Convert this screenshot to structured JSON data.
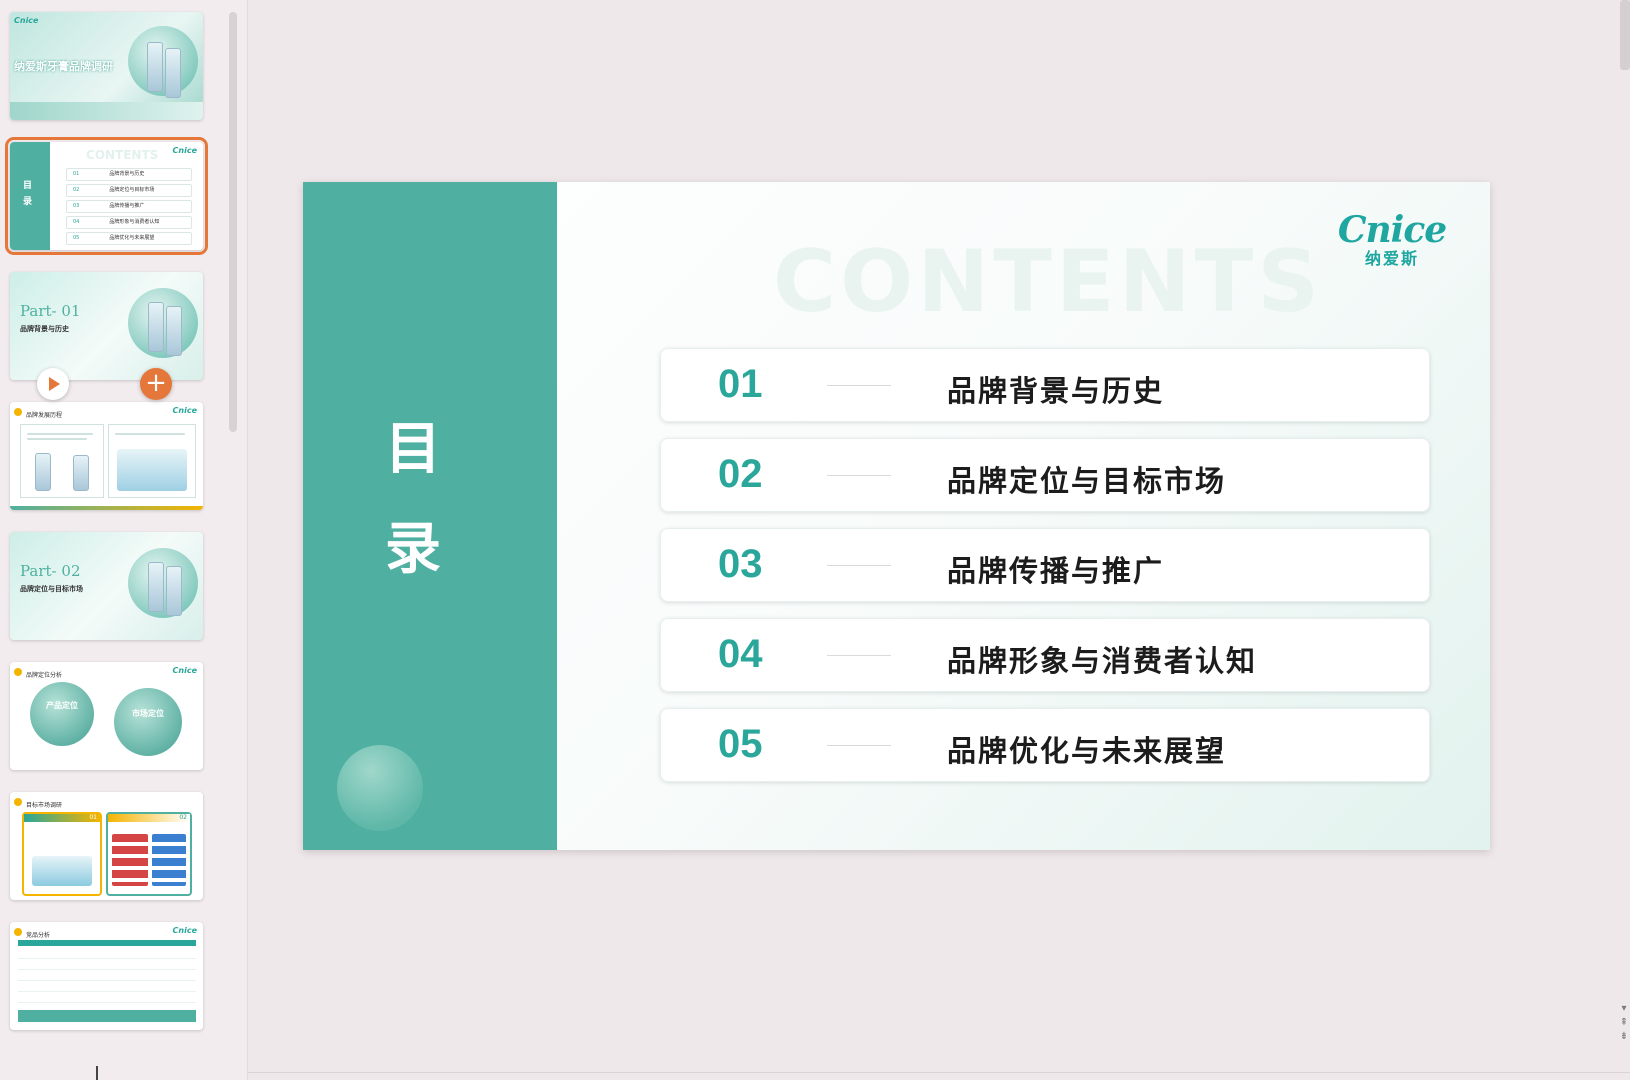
{
  "thumbnails": {
    "t1": {
      "title": "纳爱斯牙膏品牌调研",
      "logo": "Cnice"
    },
    "t2": {
      "watermark": "CONTENTS",
      "side": [
        "目",
        "录"
      ],
      "logo": "Cnice",
      "items": [
        {
          "num": "01",
          "label": "品牌背景与历史"
        },
        {
          "num": "02",
          "label": "品牌定位与目标市场"
        },
        {
          "num": "03",
          "label": "品牌传播与推广"
        },
        {
          "num": "04",
          "label": "品牌形象与消费者认知"
        },
        {
          "num": "05",
          "label": "品牌优化与未来展望"
        }
      ]
    },
    "t3": {
      "part": "Part- 01",
      "subtitle": "品牌背景与历史"
    },
    "t4": {
      "title": "品牌发展历程",
      "logo": "Cnice"
    },
    "t5": {
      "part": "Part- 02",
      "subtitle": "品牌定位与目标市场"
    },
    "t6": {
      "title": "品牌定位分析",
      "logo": "Cnice",
      "bubble1": "产品定位",
      "bubble2": "市场定位"
    },
    "t7": {
      "title": "目标市场调研",
      "num1": "01",
      "num2": "02"
    },
    "t8": {
      "title": "竞品分析",
      "logo": "Cnice"
    }
  },
  "slide": {
    "sidebar_title": [
      "目",
      "录"
    ],
    "watermark": "CONTENTS",
    "logo": {
      "en": "Cnice",
      "cn": "纳爱斯"
    },
    "items": [
      {
        "num": "01",
        "label": "品牌背景与历史"
      },
      {
        "num": "02",
        "label": "品牌定位与目标市场"
      },
      {
        "num": "03",
        "label": "品牌传播与推广"
      },
      {
        "num": "04",
        "label": "品牌形象与消费者认知"
      },
      {
        "num": "05",
        "label": "品牌优化与未来展望"
      }
    ]
  },
  "colors": {
    "accent": "#4fb0a1",
    "number": "#2aa79a",
    "selection": "#e5773a",
    "background": "#efe8ea"
  },
  "icons": {
    "play": "play-icon",
    "add": "plus-icon"
  }
}
